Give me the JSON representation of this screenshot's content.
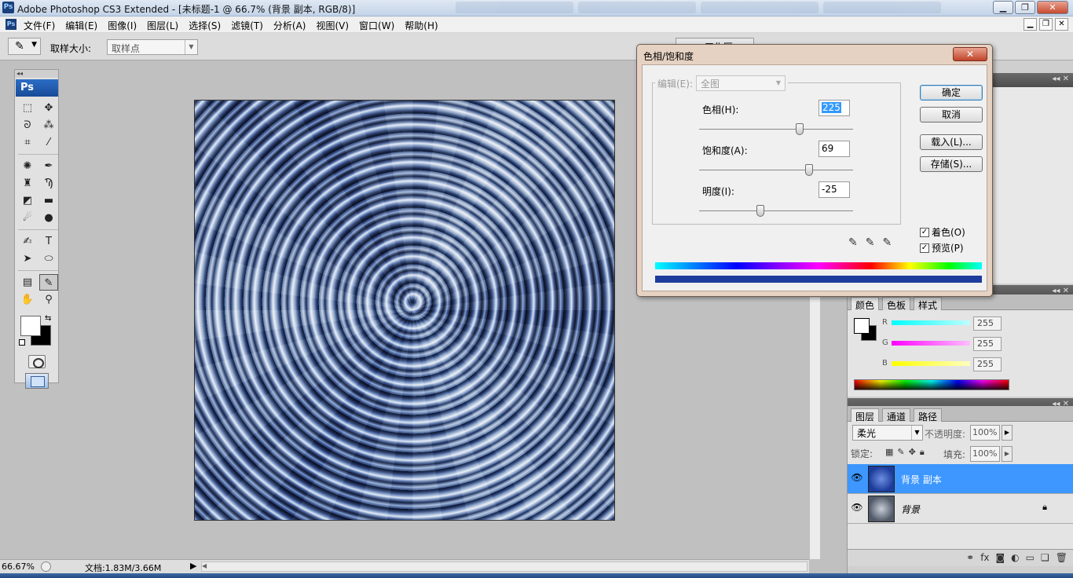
{
  "window": {
    "title": "Adobe Photoshop CS3 Extended - [未标题-1 @ 66.7% (背景 副本, RGB/8)]"
  },
  "menu": [
    "文件(F)",
    "编辑(E)",
    "图像(I)",
    "图层(L)",
    "选择(S)",
    "滤镜(T)",
    "分析(A)",
    "视图(V)",
    "窗口(W)",
    "帮助(H)"
  ],
  "options": {
    "sample_size_label": "取样大小:",
    "sample_size_value": "取样点",
    "workspace_label": "工作区"
  },
  "toolbox": {
    "logo": "Ps",
    "foreground_color": "#ffffff",
    "background_color": "#000000"
  },
  "status": {
    "zoom": "66.67%",
    "doc": "文档:1.83M/3.66M"
  },
  "dialog": {
    "title": "色相/饱和度",
    "edit_label": "编辑(E):",
    "edit_value": "全图",
    "hue_label": "色相(H):",
    "hue_value": "225",
    "sat_label": "饱和度(A):",
    "sat_value": "69",
    "light_label": "明度(I):",
    "light_value": "-25",
    "ok": "确定",
    "cancel": "取消",
    "load": "载入(L)...",
    "save": "存储(S)...",
    "colorize": "着色(O)",
    "preview": "预览(P)",
    "colorize_checked": true,
    "preview_checked": true
  },
  "color_panel": {
    "tabs": [
      "颜色",
      "色板",
      "样式"
    ],
    "channels": [
      {
        "name": "R",
        "value": "255",
        "color": "#00e5e5"
      },
      {
        "name": "G",
        "value": "255",
        "color": "#e500e5"
      },
      {
        "name": "B",
        "value": "255",
        "color": "#e5e500"
      }
    ]
  },
  "layers_panel": {
    "tabs": [
      "图层",
      "通道",
      "路径"
    ],
    "blend_mode": "柔光",
    "opacity_label": "不透明度:",
    "opacity": "100%",
    "lock_label": "锁定:",
    "fill_label": "填充:",
    "fill": "100%",
    "layers": [
      {
        "name": "背景 副本",
        "selected": true
      },
      {
        "name": "背景",
        "selected": false,
        "locked": true
      }
    ]
  }
}
